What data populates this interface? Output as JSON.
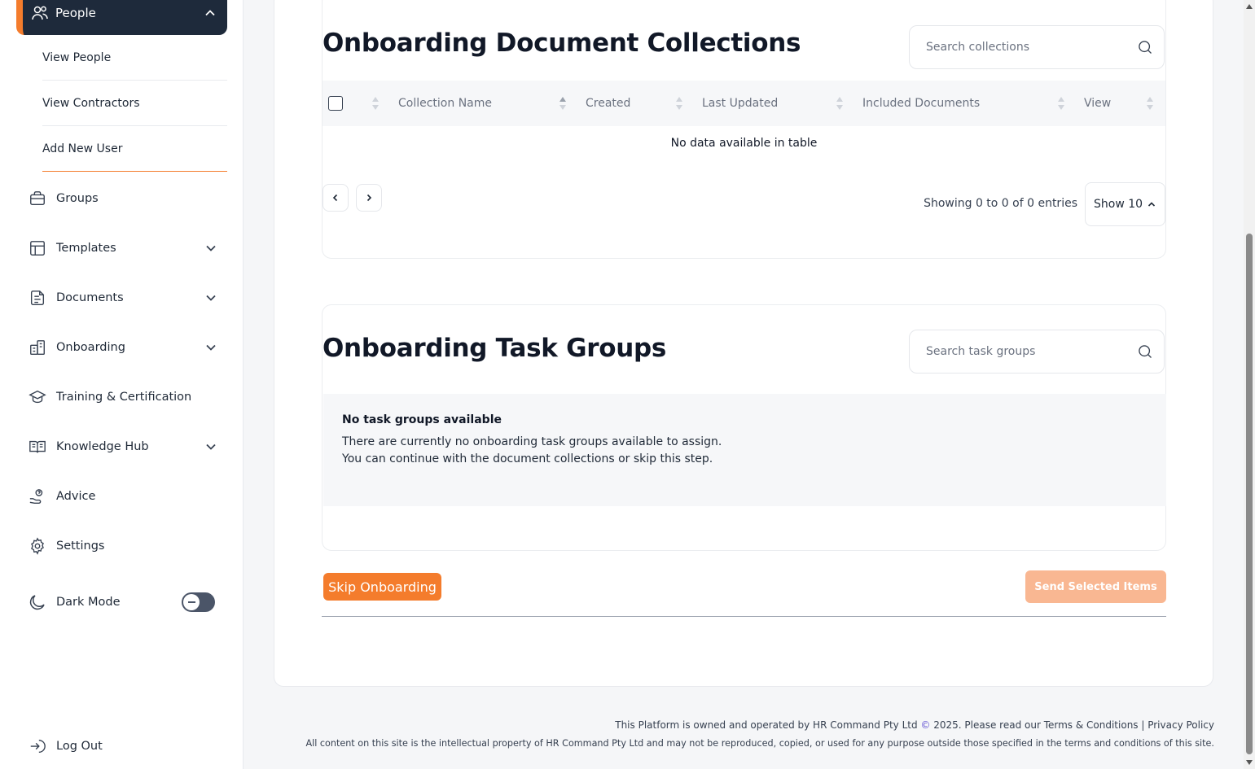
{
  "colors": {
    "accent": "#f47c2c",
    "accent_light": "#f9b792",
    "nav_dark": "#1e2a3b"
  },
  "sidebar": {
    "people": {
      "label": "People",
      "icon": "people-icon",
      "expanded": true
    },
    "people_sub": [
      {
        "label": "View People"
      },
      {
        "label": "View Contractors"
      },
      {
        "label": "Add New User"
      }
    ],
    "items": [
      {
        "label": "Groups",
        "icon": "briefcase-icon"
      },
      {
        "label": "Templates",
        "icon": "layout-icon"
      },
      {
        "label": "Documents",
        "icon": "document-edit-icon"
      },
      {
        "label": "Onboarding",
        "icon": "onboarding-icon"
      },
      {
        "label": "Training & Certification",
        "icon": "graduation-cap-icon"
      },
      {
        "label": "Knowledge Hub",
        "icon": "book-icon"
      },
      {
        "label": "Advice",
        "icon": "hand-help-icon"
      },
      {
        "label": "Settings",
        "icon": "gear-icon"
      }
    ],
    "dark_mode": {
      "label": "Dark Mode",
      "enabled": false
    },
    "logout": {
      "label": "Log Out"
    }
  },
  "collections": {
    "title": "Onboarding Document Collections",
    "search_placeholder": "Search collections",
    "columns": [
      "Collection Name",
      "Created",
      "Last Updated",
      "Included Documents",
      "View"
    ],
    "empty_text": "No data available in table",
    "showing": "Showing 0 to 0 of 0 entries",
    "page_size": "Show 10"
  },
  "task_groups": {
    "title": "Onboarding Task Groups",
    "search_placeholder": "Search task groups",
    "empty_title": "No task groups available",
    "empty_line1": "There are currently no onboarding task groups available to assign.",
    "empty_line2": "You can continue with the document collections or skip this step."
  },
  "actions": {
    "skip": "Skip Onboarding",
    "send": "Send Selected Items"
  },
  "footer": {
    "line1_pre": "This Platform is owned and operated by HR Command Pty Ltd",
    "copyright_symbol": "©",
    "line1_post": "2025. Please read our Terms & Conditions | Privacy Policy",
    "line2": "All content on this site is the intellectual property of HR Command Pty Ltd and may not be reproduced, copied, or used for any purpose outside those specified in the terms and conditions of this site."
  }
}
